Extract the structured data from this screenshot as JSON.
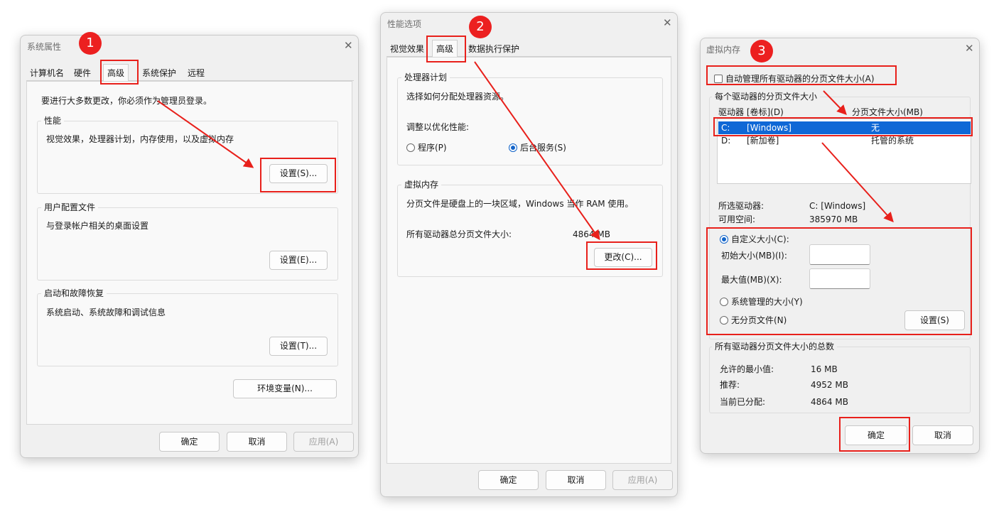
{
  "colors": {
    "accent": "#1264c9",
    "annotation_red": "#e8201b",
    "selection": "#0f68d6"
  },
  "annotations": {
    "badge1": "1",
    "badge2": "2",
    "badge3": "3"
  },
  "w1": {
    "title": "系统属性",
    "close": "✕",
    "tabs": [
      "计算机名",
      "硬件",
      "高级",
      "系统保护",
      "远程"
    ],
    "notice": "要进行大多数更改，你必须作为管理员登录。",
    "perf_title": "性能",
    "perf_desc": "视觉效果，处理器计划，内存使用，以及虚拟内存",
    "perf_btn": "设置(S)...",
    "profile_title": "用户配置文件",
    "profile_desc": "与登录帐户相关的桌面设置",
    "profile_btn": "设置(E)...",
    "startup_title": "启动和故障恢复",
    "startup_desc": "系统启动、系统故障和调试信息",
    "startup_btn": "设置(T)...",
    "env_btn": "环境变量(N)...",
    "ok": "确定",
    "cancel": "取消",
    "apply": "应用(A)"
  },
  "w2": {
    "title": "性能选项",
    "close": "✕",
    "tabs": [
      "视觉效果",
      "高级",
      "数据执行保护"
    ],
    "cpu_title": "处理器计划",
    "cpu_desc": "选择如何分配处理器资源。",
    "optimize_label": "调整以优化性能:",
    "radio_programs": "程序(P)",
    "radio_services": "后台服务(S)",
    "vm_title": "虚拟内存",
    "vm_desc": "分页文件是硬盘上的一块区域，Windows 当作 RAM 使用。",
    "vm_total_label": "所有驱动器总分页文件大小:",
    "vm_total_value": "4864 MB",
    "change_btn": "更改(C)...",
    "ok": "确定",
    "cancel": "取消",
    "apply": "应用(A)"
  },
  "w3": {
    "title": "虚拟内存",
    "close": "✕",
    "auto_manage": "自动管理所有驱动器的分页文件大小(A)",
    "each_drive_title": "每个驱动器的分页文件大小",
    "col_drive": "驱动器 [卷标](D)",
    "col_size": "分页文件大小(MB)",
    "drives": [
      {
        "letter": "C:",
        "label": "[Windows]",
        "size": "无"
      },
      {
        "letter": "D:",
        "label": "[新加卷]",
        "size": "托管的系统"
      }
    ],
    "selected_drive_label": "所选驱动器:",
    "selected_drive_value": "C:  [Windows]",
    "free_space_label": "可用空间:",
    "free_space_value": "385970 MB",
    "custom_size": "自定义大小(C):",
    "initial_size_label": "初始大小(MB)(I):",
    "initial_size_value": "",
    "max_size_label": "最大值(MB)(X):",
    "max_size_value": "",
    "system_managed": "系统管理的大小(Y)",
    "no_paging": "无分页文件(N)",
    "set_btn": "设置(S)",
    "total_title": "所有驱动器分页文件大小的总数",
    "min_allowed_label": "允许的最小值:",
    "min_allowed_value": "16 MB",
    "recommended_label": "推荐:",
    "recommended_value": "4952 MB",
    "current_label": "当前已分配:",
    "current_value": "4864 MB",
    "ok": "确定",
    "cancel": "取消"
  }
}
